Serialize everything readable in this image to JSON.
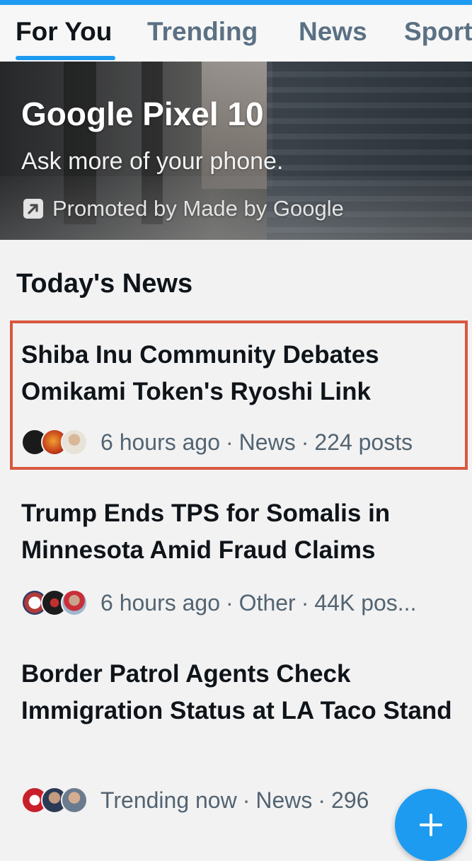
{
  "tabs": [
    {
      "label": "For You",
      "active": true
    },
    {
      "label": "Trending",
      "active": false
    },
    {
      "label": "News",
      "active": false
    },
    {
      "label": "Sport",
      "active": false
    }
  ],
  "promo": {
    "title": "Google Pixel 10",
    "subtitle": "Ask more of your phone.",
    "promoted_by": "Promoted by Made by Google",
    "icon": "promoted-arrow-icon"
  },
  "section": {
    "title": "Today's News"
  },
  "news": [
    {
      "headline": "Shiba Inu Community Debates Omikami Token's Ryoshi Link",
      "time": "6 hours ago",
      "category": "News",
      "posts": "224 posts",
      "avatar_colors": [
        "#1a1a1a",
        "#c43b1a",
        "#e8e2d8"
      ]
    },
    {
      "headline": "Trump Ends TPS for Somalis in Minnesota Amid Fraud Claims",
      "time": "6 hours ago",
      "category": "Other",
      "posts": "44K pos...",
      "avatar_colors": [
        "#b23a3a",
        "#1c1c1c",
        "#c92f3a"
      ]
    },
    {
      "headline": "Border Patrol Agents Check Immigration Status at LA Taco Stand",
      "time": "Trending now",
      "category": "News",
      "posts": "296",
      "avatar_colors": [
        "#c8202a",
        "#2b3a55",
        "#6b7b8f"
      ]
    }
  ],
  "fab": {
    "icon": "plus-icon"
  },
  "colors": {
    "accent": "#1d9bf0",
    "highlight": "#d9573f",
    "text": "#0f1419",
    "muted": "#536471"
  }
}
